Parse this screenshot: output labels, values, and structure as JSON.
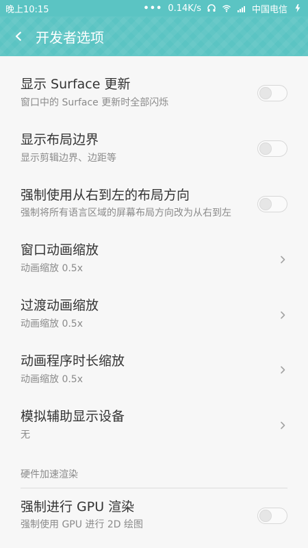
{
  "status_bar": {
    "time": "晚上10:15",
    "dots": "•••",
    "speed": "0.14K/s",
    "carrier": "中国电信"
  },
  "header": {
    "title": "开发者选项"
  },
  "settings": {
    "surface_updates": {
      "title": "显示 Surface 更新",
      "subtitle": "窗口中的 Surface 更新时全部闪烁"
    },
    "layout_bounds": {
      "title": "显示布局边界",
      "subtitle": "显示剪辑边界、边距等"
    },
    "rtl_layout": {
      "title": "强制使用从右到左的布局方向",
      "subtitle": "强制将所有语言区域的屏幕布局方向改为从右到左"
    },
    "window_animation": {
      "title": "窗口动画缩放",
      "subtitle": "动画缩放 0.5x"
    },
    "transition_animation": {
      "title": "过渡动画缩放",
      "subtitle": "动画缩放 0.5x"
    },
    "animator_duration": {
      "title": "动画程序时长缩放",
      "subtitle": "动画缩放 0.5x"
    },
    "secondary_display": {
      "title": "模拟辅助显示设备",
      "subtitle": "无"
    },
    "hardware_section": {
      "label": "硬件加速渲染"
    },
    "force_gpu": {
      "title": "强制进行 GPU 渲染",
      "subtitle": "强制使用 GPU 进行 2D 绘图"
    }
  }
}
